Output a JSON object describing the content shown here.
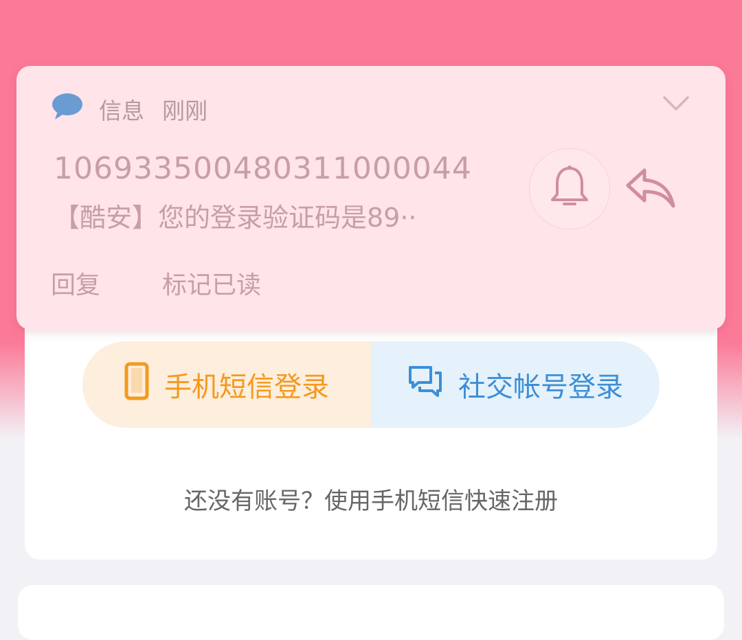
{
  "notification": {
    "app_name": "信息",
    "time": "刚刚",
    "sender": "106933500480311000044",
    "body": "【酷安】您的登录验证码是89··",
    "actions": {
      "reply": "回复",
      "mark_read": "标记已读"
    },
    "icons": [
      "message-bubble-icon",
      "chevron-down-icon",
      "bell-icon",
      "reply-arrow-icon"
    ]
  },
  "login": {
    "sms_label": "手机短信登录",
    "social_label": "社交帐号登录",
    "register_text": "还没有账号？使用手机短信快速注册",
    "icons": [
      "phone-icon",
      "chat-bubbles-icon"
    ]
  },
  "colors": {
    "header_pink": "#fb7a98",
    "notification_bg": "#ffe4e9",
    "sms_orange": "#f29a1f",
    "social_blue": "#3d8ed6"
  }
}
